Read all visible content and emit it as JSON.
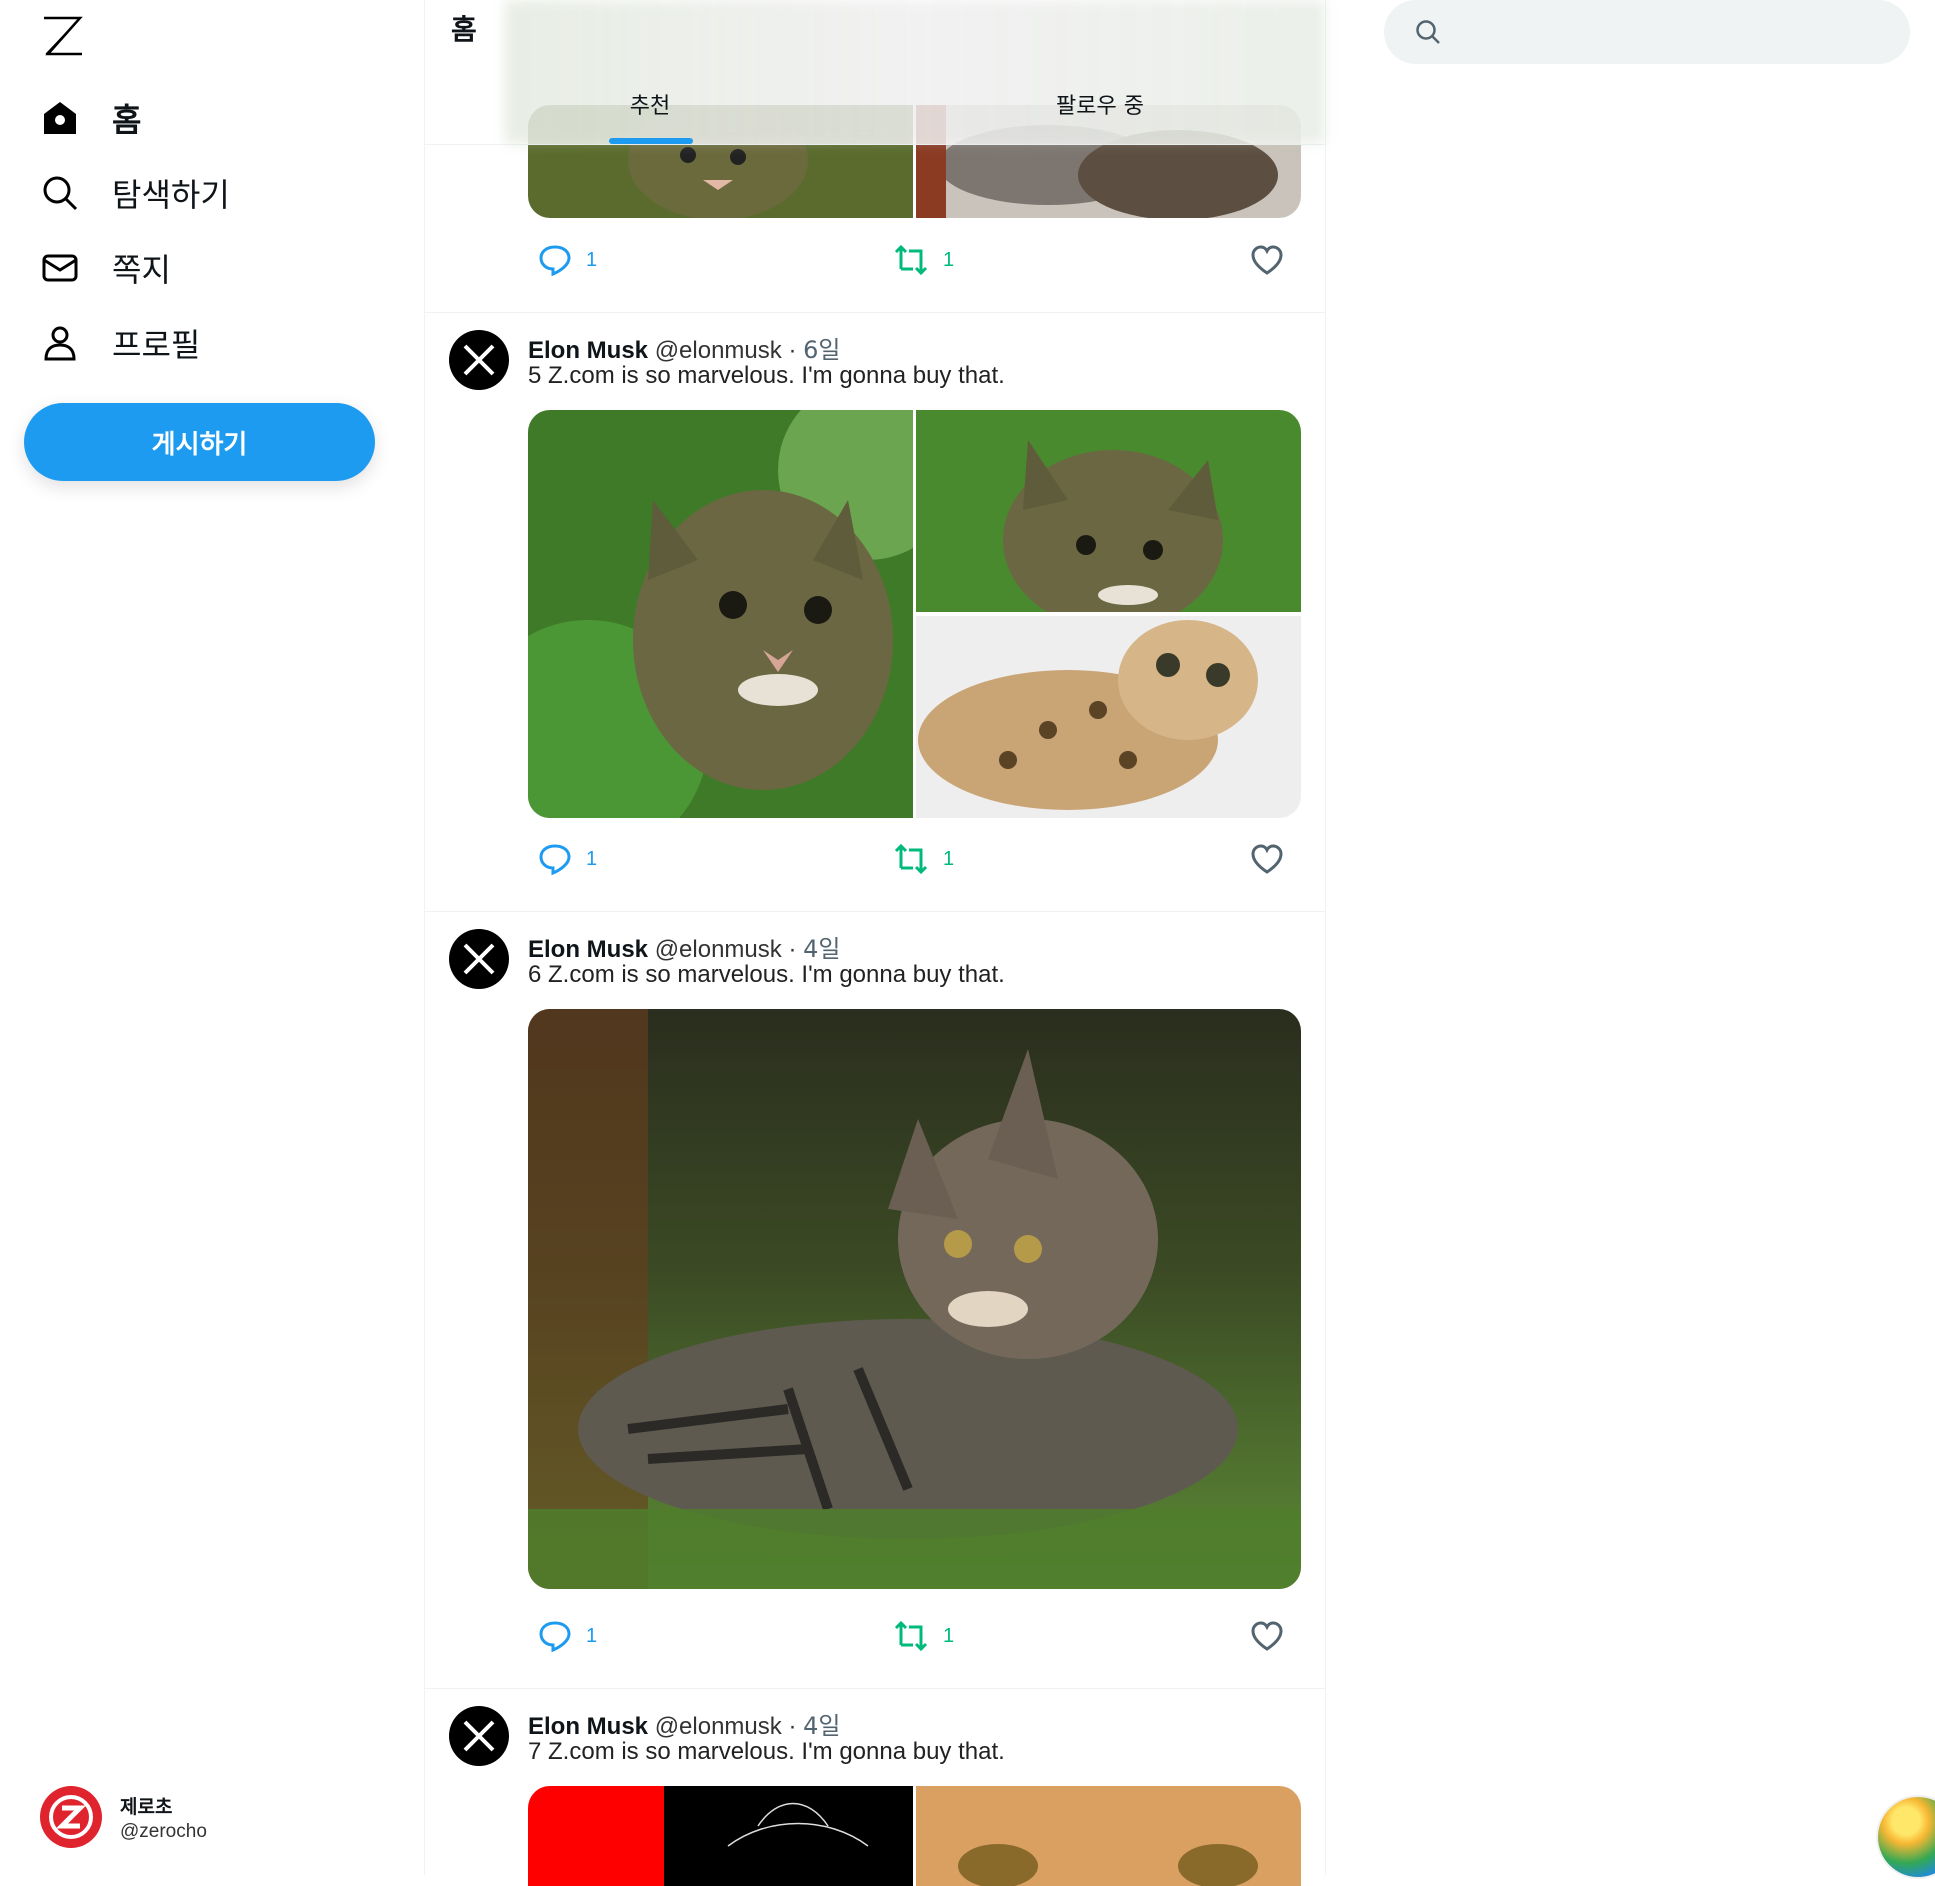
{
  "sidebar": {
    "logo": "Z",
    "nav": [
      {
        "label": "홈",
        "icon": "home-icon",
        "active": true
      },
      {
        "label": "탐색하기",
        "icon": "search-icon",
        "active": false
      },
      {
        "label": "쪽지",
        "icon": "mail-icon",
        "active": false
      },
      {
        "label": "프로필",
        "icon": "person-icon",
        "active": false
      }
    ],
    "post_button": "게시하기",
    "me": {
      "name": "제로초",
      "handle": "@zerocho"
    }
  },
  "header": {
    "title": "홈",
    "tabs": [
      {
        "label": "추천",
        "active": true
      },
      {
        "label": "팔로우 중",
        "active": false
      }
    ]
  },
  "posts": [
    {
      "partial": true,
      "replies": "1",
      "reposts": "1"
    },
    {
      "author": "Elon Musk",
      "handle": "@elonmusk",
      "dot": "·",
      "time": "6일",
      "text": "5 Z.com is so marvelous. I'm gonna buy that.",
      "images": [
        "kitten-in-leaves",
        "kitten-in-leaves-crop",
        "bengal-cat-on-fur"
      ],
      "replies": "1",
      "reposts": "1"
    },
    {
      "author": "Elon Musk",
      "handle": "@elonmusk",
      "dot": "·",
      "time": "4일",
      "text": "6 Z.com is so marvelous. I'm gonna buy that.",
      "images": [
        "tabby-cat-in-grass"
      ],
      "replies": "1",
      "reposts": "1"
    },
    {
      "author": "Elon Musk",
      "handle": "@elonmusk",
      "dot": "·",
      "time": "4일",
      "text": "7 Z.com is so marvelous. I'm gonna buy that.",
      "images": [
        "red-black-cat",
        "orange-cat-closeup"
      ],
      "replies": "",
      "reposts": ""
    }
  ],
  "search": {
    "placeholder": "",
    "value": ""
  },
  "colors": {
    "accent": "#1d9bf0",
    "repost": "#00ba7c",
    "text": "#0f1419",
    "muted": "#536471",
    "border": "#eff3f4"
  }
}
